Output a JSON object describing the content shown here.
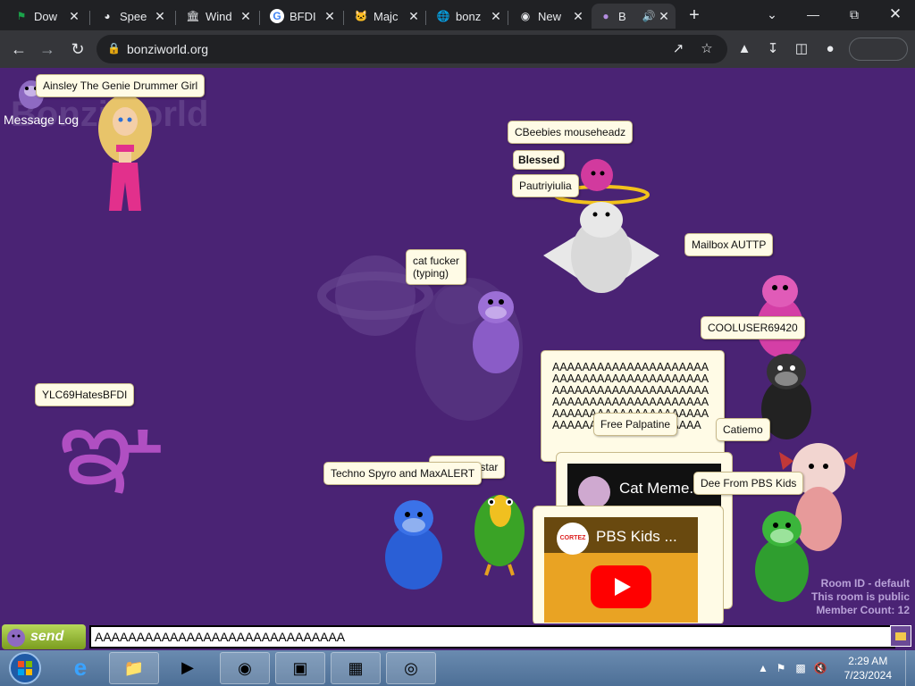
{
  "browser": {
    "tabs": [
      {
        "title": "Dow",
        "icon": "flag-icon"
      },
      {
        "title": "Spee",
        "icon": "speedometer-icon"
      },
      {
        "title": "Wind",
        "icon": "columns-icon"
      },
      {
        "title": "BFDI",
        "icon": "google-icon"
      },
      {
        "title": "Majc",
        "icon": "cat-icon"
      },
      {
        "title": "bonz",
        "icon": "globe-icon"
      },
      {
        "title": "New",
        "icon": "chrome-icon"
      },
      {
        "title": "B",
        "icon": "bonzi-icon",
        "active": true
      }
    ],
    "new_tab_label": "+",
    "url": "bonziworld.org"
  },
  "page": {
    "message_log_label": "Message Log",
    "logo_text": "BonziWorld",
    "bubbles": [
      {
        "id": "ainsley",
        "text": "Ainsley The Genie Drummer Girl"
      },
      {
        "id": "cbeebies",
        "text": "CBeebies mouseheadz"
      },
      {
        "id": "blessed",
        "text": "Blessed"
      },
      {
        "id": "pautriy",
        "text": "Pautriyiulia"
      },
      {
        "id": "mailbox",
        "text": "Mailbox AUTTP"
      },
      {
        "id": "catf",
        "text": "cat fucker\n(typing)"
      },
      {
        "id": "cooluser",
        "text": "COOLUSER69420"
      },
      {
        "id": "ylc",
        "text": "YLC69HatesBFDI"
      },
      {
        "id": "freepal",
        "text": "Free Palpatine"
      },
      {
        "id": "catiemo",
        "text": "Catiemo"
      },
      {
        "id": "homestar",
        "text": "ing homestar"
      },
      {
        "id": "techno",
        "text": "Techno Spyro and MaxALERT"
      },
      {
        "id": "dee",
        "text": "Dee From PBS Kids"
      }
    ],
    "big_message": "AAAAAAAAAAAAAAAAAAAAAAAAAAAAAAAAAAAAAAAAAAAAAAAAAAAAAAAAAAAAAAAAAAAAAAAAAAAAAAAAAAAAAAAAAAAAAAAAAAAAAAAAAAAAAAAAAAAAAAAAAAAAA",
    "glyph": "ఞ",
    "videos": [
      {
        "title": "Cat Meme..."
      },
      {
        "title": "PBS Kids ...",
        "channel": "CORTEZ"
      }
    ],
    "room": {
      "room_id": "Room ID - default",
      "public": "This room is public",
      "member_count": "Member Count: 12"
    }
  },
  "chat": {
    "send_label": "send",
    "input_value": "AAAAAAAAAAAAAAAAAAAAAAAAAAAAAA"
  },
  "taskbar": {
    "time": "2:29 AM",
    "date": "7/23/2024"
  }
}
